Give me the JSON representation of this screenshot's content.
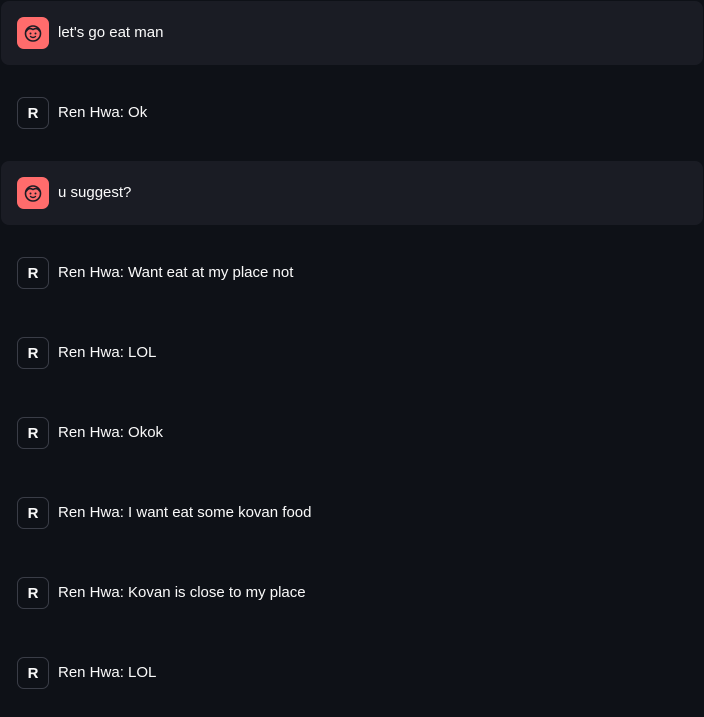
{
  "colors": {
    "background": "#0e1117",
    "user_bubble": "#1a1c24",
    "user_avatar": "#ff6c6c",
    "text": "#fafafa"
  },
  "messages": [
    {
      "role": "user",
      "avatar_icon": "face-icon",
      "text": "let's go eat man"
    },
    {
      "role": "assistant",
      "avatar_letter": "R",
      "text": "Ren Hwa: Ok"
    },
    {
      "role": "user",
      "avatar_icon": "face-icon",
      "text": "u suggest?"
    },
    {
      "role": "assistant",
      "avatar_letter": "R",
      "text": "Ren Hwa: Want eat at my place not"
    },
    {
      "role": "assistant",
      "avatar_letter": "R",
      "text": "Ren Hwa: LOL"
    },
    {
      "role": "assistant",
      "avatar_letter": "R",
      "text": "Ren Hwa: Okok"
    },
    {
      "role": "assistant",
      "avatar_letter": "R",
      "text": "Ren Hwa: I want eat some kovan food"
    },
    {
      "role": "assistant",
      "avatar_letter": "R",
      "text": "Ren Hwa: Kovan is close to my place"
    },
    {
      "role": "assistant",
      "avatar_letter": "R",
      "text": "Ren Hwa: LOL"
    }
  ]
}
